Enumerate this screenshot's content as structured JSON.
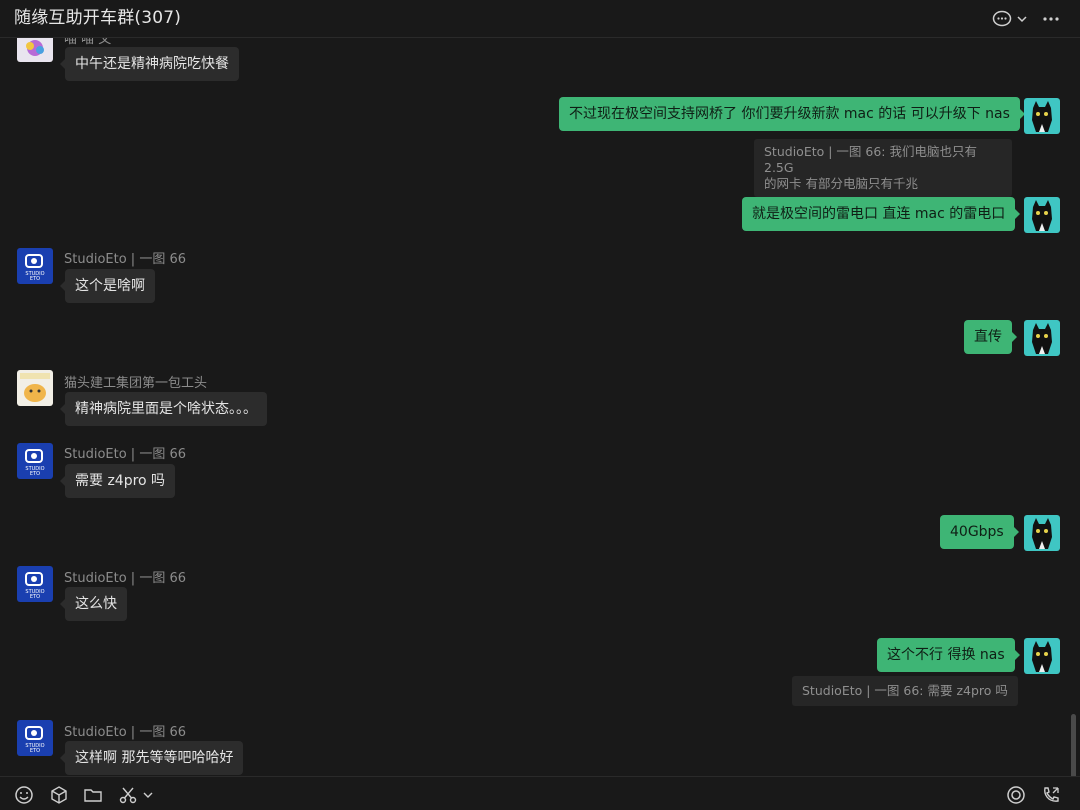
{
  "header": {
    "title": "随缘互助开车群(307)",
    "icons": [
      "chat-bubble-icon",
      "chevron-down-icon",
      "more-icon"
    ]
  },
  "partial_sender": {
    "name": "喵 喵 文"
  },
  "messages": [
    {
      "side": "in",
      "text": "中午还是精神病院吃快餐"
    },
    {
      "side": "out",
      "text": "不过现在极空间支持网桥了 你们要升级新款 mac 的话 可以升级下 nas"
    },
    {
      "side": "quote",
      "line1": "StudioEto | 一图   66: 我们电脑也只有 2.5G",
      "line2": "的网卡 有部分电脑只有千兆"
    },
    {
      "side": "out",
      "text": "就是极空间的雷电口 直连 mac 的雷电口"
    },
    {
      "side": "in",
      "sender": "StudioEto | 一图   66",
      "text": "这个是啥啊"
    },
    {
      "side": "out",
      "text": "直传"
    },
    {
      "side": "in",
      "sender": "猫头建工集团第一包工头",
      "text": "精神病院里面是个啥状态。。。"
    },
    {
      "side": "in",
      "sender": "StudioEto | 一图   66",
      "text": "需要 z4pro 吗"
    },
    {
      "side": "out",
      "text": "40Gbps"
    },
    {
      "side": "in",
      "sender": "StudioEto | 一图   66",
      "text": "这么快"
    },
    {
      "side": "out",
      "text": "这个不行 得换 nas"
    },
    {
      "side": "quote",
      "line1": "StudioEto | 一图   66: 需要 z4pro 吗"
    },
    {
      "side": "in",
      "sender": "StudioEto | 一图   66",
      "text": "这样啊 那先等等吧哈哈好"
    }
  ],
  "toolbar": {
    "left_icons": [
      "emoji-icon",
      "cube-icon",
      "folder-icon",
      "scissors-icon",
      "chevron-down-icon"
    ],
    "right_icons": [
      "voice-icon",
      "phone-icon"
    ]
  },
  "avatar_text": {
    "studio_line1": "STUDIO",
    "studio_line2": "ETO"
  },
  "colors": {
    "background": "#191919",
    "incoming_bubble": "#2c2c2c",
    "outgoing_bubble": "#3eb575",
    "text": "#e4e4e4"
  }
}
